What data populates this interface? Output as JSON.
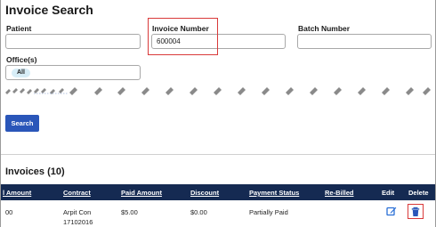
{
  "page": {
    "title": "Invoice Search"
  },
  "filters": {
    "patient_label": "Patient",
    "patient_value": "",
    "invoice_number_label": "Invoice Number",
    "invoice_number_value": "600004",
    "batch_number_label": "Batch Number",
    "batch_number_value": "",
    "offices_label": "Office(s)",
    "offices_selected": "All"
  },
  "search_button": "Search",
  "invoices": {
    "title": "Invoices (10)",
    "columns": [
      "l Amount",
      "Contract",
      "Paid Amount",
      "Discount",
      "Payment Status",
      "Re-Billed",
      "Edit",
      "Delete"
    ],
    "rows": [
      {
        "amount": "00",
        "contract_line1": "Arpit Con",
        "contract_line2": "17102016",
        "paid_amount": "$5.00",
        "discount": "$0.00",
        "payment_status": "Partially Paid",
        "re_billed": ""
      }
    ]
  },
  "colors": {
    "accent": "#2a56b9",
    "table_header": "#152a52",
    "highlight": "#d93a3a"
  },
  "icons": {
    "edit": "pencil-square-icon",
    "delete": "trash-icon"
  }
}
